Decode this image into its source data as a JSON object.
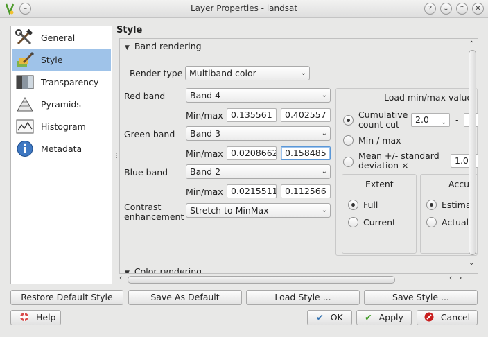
{
  "window": {
    "title": "Layer Properties - landsat"
  },
  "nav": {
    "items": [
      {
        "label": "General",
        "icon": "tools-icon"
      },
      {
        "label": "Style",
        "icon": "paintbrush-icon"
      },
      {
        "label": "Transparency",
        "icon": "transparency-icon"
      },
      {
        "label": "Pyramids",
        "icon": "pyramid-icon"
      },
      {
        "label": "Histogram",
        "icon": "histogram-icon"
      },
      {
        "label": "Metadata",
        "icon": "info-icon"
      }
    ],
    "selected": "Style"
  },
  "style": {
    "heading": "Style",
    "band_rendering": {
      "title": "Band rendering",
      "render_type_label": "Render type",
      "render_type_value": "Multiband color",
      "red_label": "Red band",
      "red_value": "Band 4",
      "red_min": "0.135561",
      "red_max": "0.402557",
      "green_label": "Green band",
      "green_value": "Band 3",
      "green_min": "0.0208662",
      "green_max": "0.158485",
      "blue_label": "Blue band",
      "blue_value": "Band 2",
      "blue_min": "0.0215511",
      "blue_max": "0.112566",
      "minmax_label": "Min/max",
      "contrast_label": "Contrast enhancement",
      "contrast_value": "Stretch to MinMax"
    },
    "load_minmax": {
      "title": "Load min/max value",
      "cumulative_label": "Cumulative count cut",
      "cumulative_value": "2.0",
      "dash": "-",
      "minmax_option": "Min / max",
      "mean_label": "Mean +/- standard deviation ×",
      "mean_value": "1.0",
      "selected": "Cumulative count cut",
      "extent": {
        "title": "Extent",
        "full": "Full",
        "current": "Current",
        "selected": "Full"
      },
      "accuracy": {
        "title": "Accu",
        "estimate": "Estima",
        "actual": "Actual",
        "selected": "Estima"
      }
    },
    "color_rendering": {
      "title": "Color rendering"
    }
  },
  "buttons": {
    "restore_default": "Restore Default Style",
    "save_default": "Save As Default",
    "load_style": "Load Style ...",
    "save_style": "Save Style ...",
    "help": "Help",
    "ok": "OK",
    "apply": "Apply",
    "cancel": "Cancel"
  },
  "colors": {
    "selection": "#9fc3e9",
    "ok_check": "#2f6fb0",
    "apply_check": "#3d9b22",
    "cancel_icon": "#c81e1e"
  }
}
